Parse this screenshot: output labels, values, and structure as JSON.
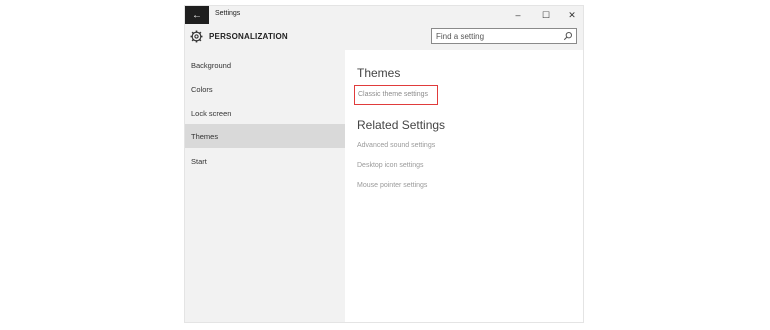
{
  "titlebar": {
    "back_glyph": "←",
    "title": "Settings",
    "minimize_glyph": "–",
    "maximize_glyph": "☐",
    "close_glyph": "✕"
  },
  "header": {
    "icon": "gear-icon",
    "title": "PERSONALIZATION",
    "search_placeholder": "Find a setting",
    "search_icon": "search-icon"
  },
  "sidebar": {
    "items": [
      {
        "label": "Background",
        "selected": false
      },
      {
        "label": "Colors",
        "selected": false
      },
      {
        "label": "Lock screen",
        "selected": false
      },
      {
        "label": "Themes",
        "selected": true
      },
      {
        "label": "Start",
        "selected": false
      }
    ]
  },
  "content": {
    "themes_heading": "Themes",
    "classic_link": "Classic theme settings",
    "related_heading": "Related Settings",
    "related_links": [
      "Advanced sound settings",
      "Desktop icon settings",
      "Mouse pointer settings"
    ]
  },
  "colors": {
    "highlight_border": "#e03b3b",
    "selected_nav": "#d9d9d9",
    "back_button": "#1f1f1f"
  }
}
